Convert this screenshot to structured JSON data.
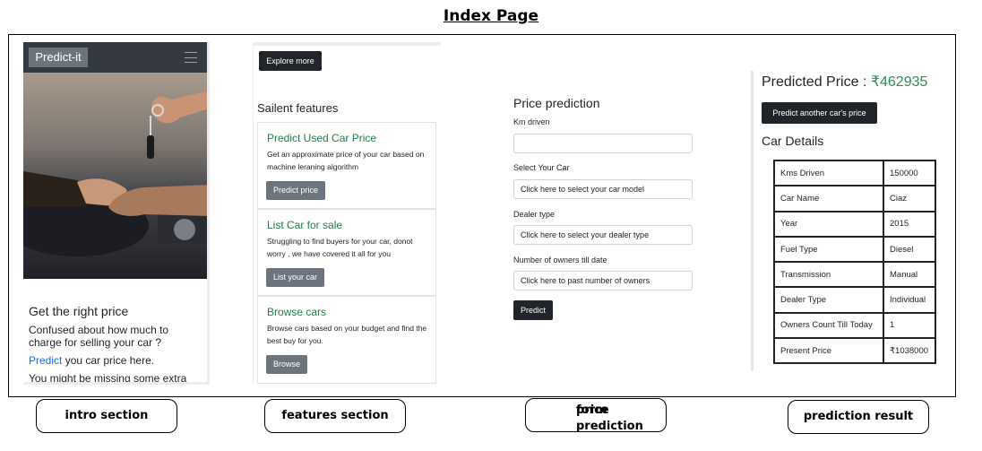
{
  "page_heading": "Index Page",
  "intro": {
    "brand": "Predict-it",
    "title": "Get the right price",
    "text": "Confused about how much to charge for selling your car ?",
    "link": "Predict",
    "link_rest": " you car price here.",
    "cut_text": "You might be missing some extra"
  },
  "features": {
    "explore_label": "Explore more",
    "title": "Sailent features",
    "cards": [
      {
        "title": "Predict Used Car Price",
        "text": "Get an approximate price of your car based on machine leraning algorithm",
        "button": "Predict price"
      },
      {
        "title": "List Car for sale",
        "text": "Struggling to find buyers for your car, donot worry , we have covered it all for you",
        "button": "List your car"
      },
      {
        "title": "Browse cars",
        "text": "Browse cars based on your budget and find the best buy for you.",
        "button": "Browse"
      }
    ]
  },
  "form": {
    "title": "Price prediction",
    "km_label": "Km driven",
    "km_value": "",
    "car_label": "Select Your Car",
    "car_placeholder": "Click here to select your car model",
    "dealer_label": "Dealer type",
    "dealer_placeholder": "Click here to select your dealer type",
    "owners_label": "Number of owners till date",
    "owners_placeholder": "Click here to past number of owners",
    "submit_label": "Predict"
  },
  "result": {
    "heading": "Predicted Price : ",
    "value": "₹462935",
    "again_label": "Predict another car's price",
    "details_title": "Car Details",
    "rows": [
      {
        "label": "Kms Driven",
        "value": "150000"
      },
      {
        "label": "Car Name",
        "value": "Ciaz"
      },
      {
        "label": "Year",
        "value": "2015"
      },
      {
        "label": "Fuel Type",
        "value": "Diesel"
      },
      {
        "label": "Transmission",
        "value": "Manual"
      },
      {
        "label": "Dealer Type",
        "value": "Individual"
      },
      {
        "label": "Owners Count Till Today",
        "value": "1"
      },
      {
        "label": "Present Price",
        "value": "₹1038000"
      }
    ]
  },
  "captions": {
    "intro": "intro section",
    "features": "features section",
    "form_line1": "price prediction",
    "form_line2": "form",
    "result": "prediction result"
  },
  "colors": {
    "accent_green": "#2e8b57",
    "dark_button": "#212529",
    "grey_button": "#6c757d",
    "link_blue": "#0d6efd"
  },
  "icons": [
    "menu-icon",
    "car-keys-handshake-image"
  ]
}
